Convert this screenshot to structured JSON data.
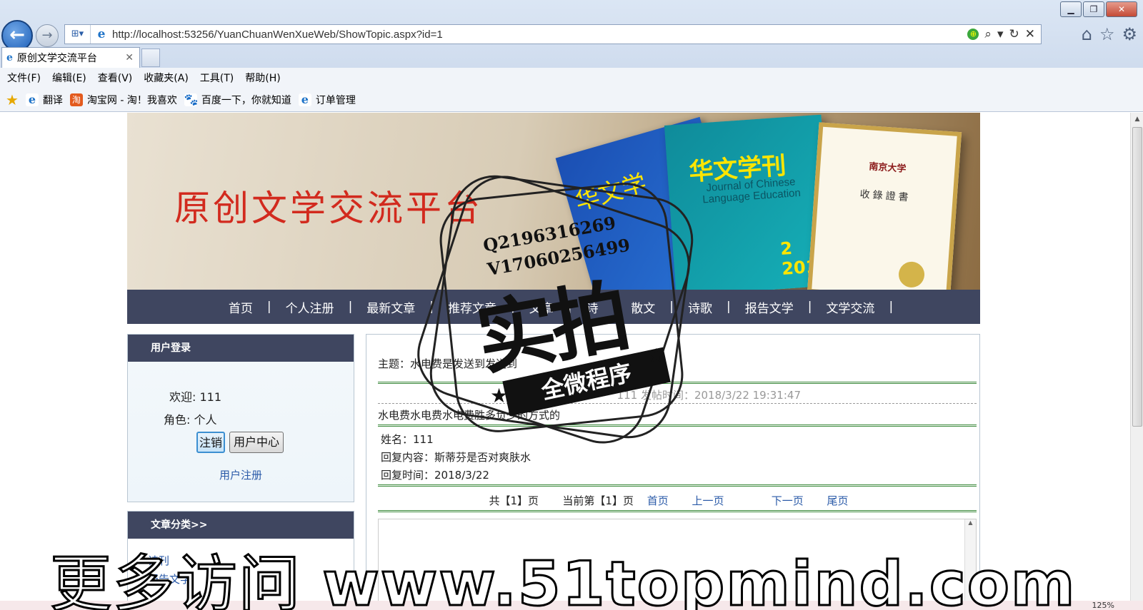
{
  "browser": {
    "url": "http://localhost:53256/YuanChuanWenXueWeb/ShowTopic.aspx?id=1",
    "tab_title": "原创文学交流平台",
    "menu": [
      "文件(F)",
      "编辑(E)",
      "查看(V)",
      "收藏夹(A)",
      "工具(T)",
      "帮助(H)"
    ],
    "favorites": [
      {
        "label": "翻译",
        "icon": "ie-icon"
      },
      {
        "label": "淘宝网 - 淘！我喜欢",
        "icon": "taobao-icon"
      },
      {
        "label": "百度一下，你就知道",
        "icon": "baidu-icon"
      },
      {
        "label": "订单管理",
        "icon": "ie-icon"
      }
    ],
    "zoom": "125%"
  },
  "banner": {
    "site_title": "原创文学交流平台",
    "book1_title": "华文学",
    "book2_title": "华文学刊",
    "book2_subtitle": "Journal of Chinese Language Education",
    "book2_number": "2 2014",
    "cert_head": "南京大学",
    "cert_title": "收錄證書"
  },
  "nav": [
    "首页",
    "个人注册",
    "最新文章",
    "推荐文章",
    "文章",
    "诗",
    "散文",
    "诗歌",
    "报告文学",
    "文学交流"
  ],
  "login": {
    "header": "用户登录",
    "welcome_label": "欢迎:",
    "welcome_user": "111",
    "role_label": "角色:",
    "role_value": "个人",
    "logout_btn": "注销",
    "center_btn": "用户中心",
    "register_link": "用户注册"
  },
  "category": {
    "header": "文章分类>>",
    "items": [
      "诗刊",
      "报告文学"
    ]
  },
  "topic": {
    "subject_label": "主题：",
    "subject": "水电费是发送到发送到",
    "meta": "111 发帖时间：2018/3/22 19:31:47",
    "body": "水电费水电费水电费胜多负少的方式的"
  },
  "reply": {
    "name_label": "姓名：",
    "name": "111",
    "content_label": "回复内容：",
    "content": "斯蒂芬是否对爽肤水",
    "time_label": "回复时间：",
    "time": "2018/3/22"
  },
  "pager": {
    "total": "共【1】页",
    "current": "当前第【1】页",
    "first": "首页",
    "prev": "上一页",
    "next": "下一页",
    "last": "尾页"
  },
  "watermark": {
    "contact_q": "Q2196316269",
    "contact_v": "V17060256499",
    "big": "实拍",
    "ribbon": "全微程序",
    "bottom_prefix": "更多访问",
    "bottom_url": "www.51topmind.com"
  }
}
